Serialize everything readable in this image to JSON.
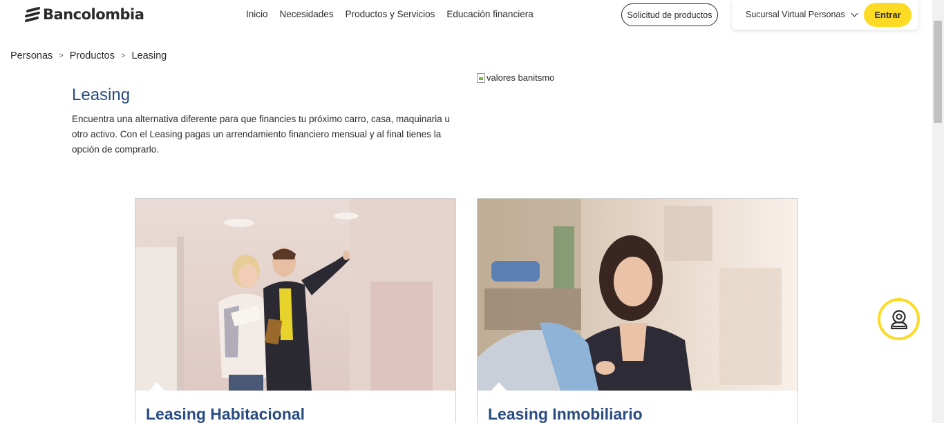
{
  "brand": {
    "name": "Bancolombia"
  },
  "nav": {
    "items": [
      {
        "label": "Inicio"
      },
      {
        "label": "Necesidades"
      },
      {
        "label": "Productos y Servicios"
      },
      {
        "label": "Educación financiera"
      }
    ],
    "solicitud_label": "Solicitud de productos",
    "sucursal_label": "Sucursal Virtual Personas",
    "entrar_label": "Entrar"
  },
  "breadcrumb": {
    "items": [
      "Personas",
      "Productos",
      "Leasing"
    ],
    "separator": ">"
  },
  "hero": {
    "title": "Leasing",
    "description": "Encuentra una alternativa diferente para que financies tu próximo carro, casa, maquinaria u otro activo. Con el Leasing pagas un arrendamiento financiero mensual y al final tienes la opción de comprarlo.",
    "image_alt": "valores banitsmo"
  },
  "cards": [
    {
      "title": "Leasing Habitacional"
    },
    {
      "title": "Leasing Inmobiliario"
    }
  ],
  "colors": {
    "accent_yellow": "#fdda24",
    "title_blue": "#2a4c81",
    "text_dark": "#2c2a29"
  },
  "icons": {
    "brand": "bancolombia-logo-icon",
    "chat": "chat-assistant-icon",
    "chevron": "chevron-down-icon"
  }
}
